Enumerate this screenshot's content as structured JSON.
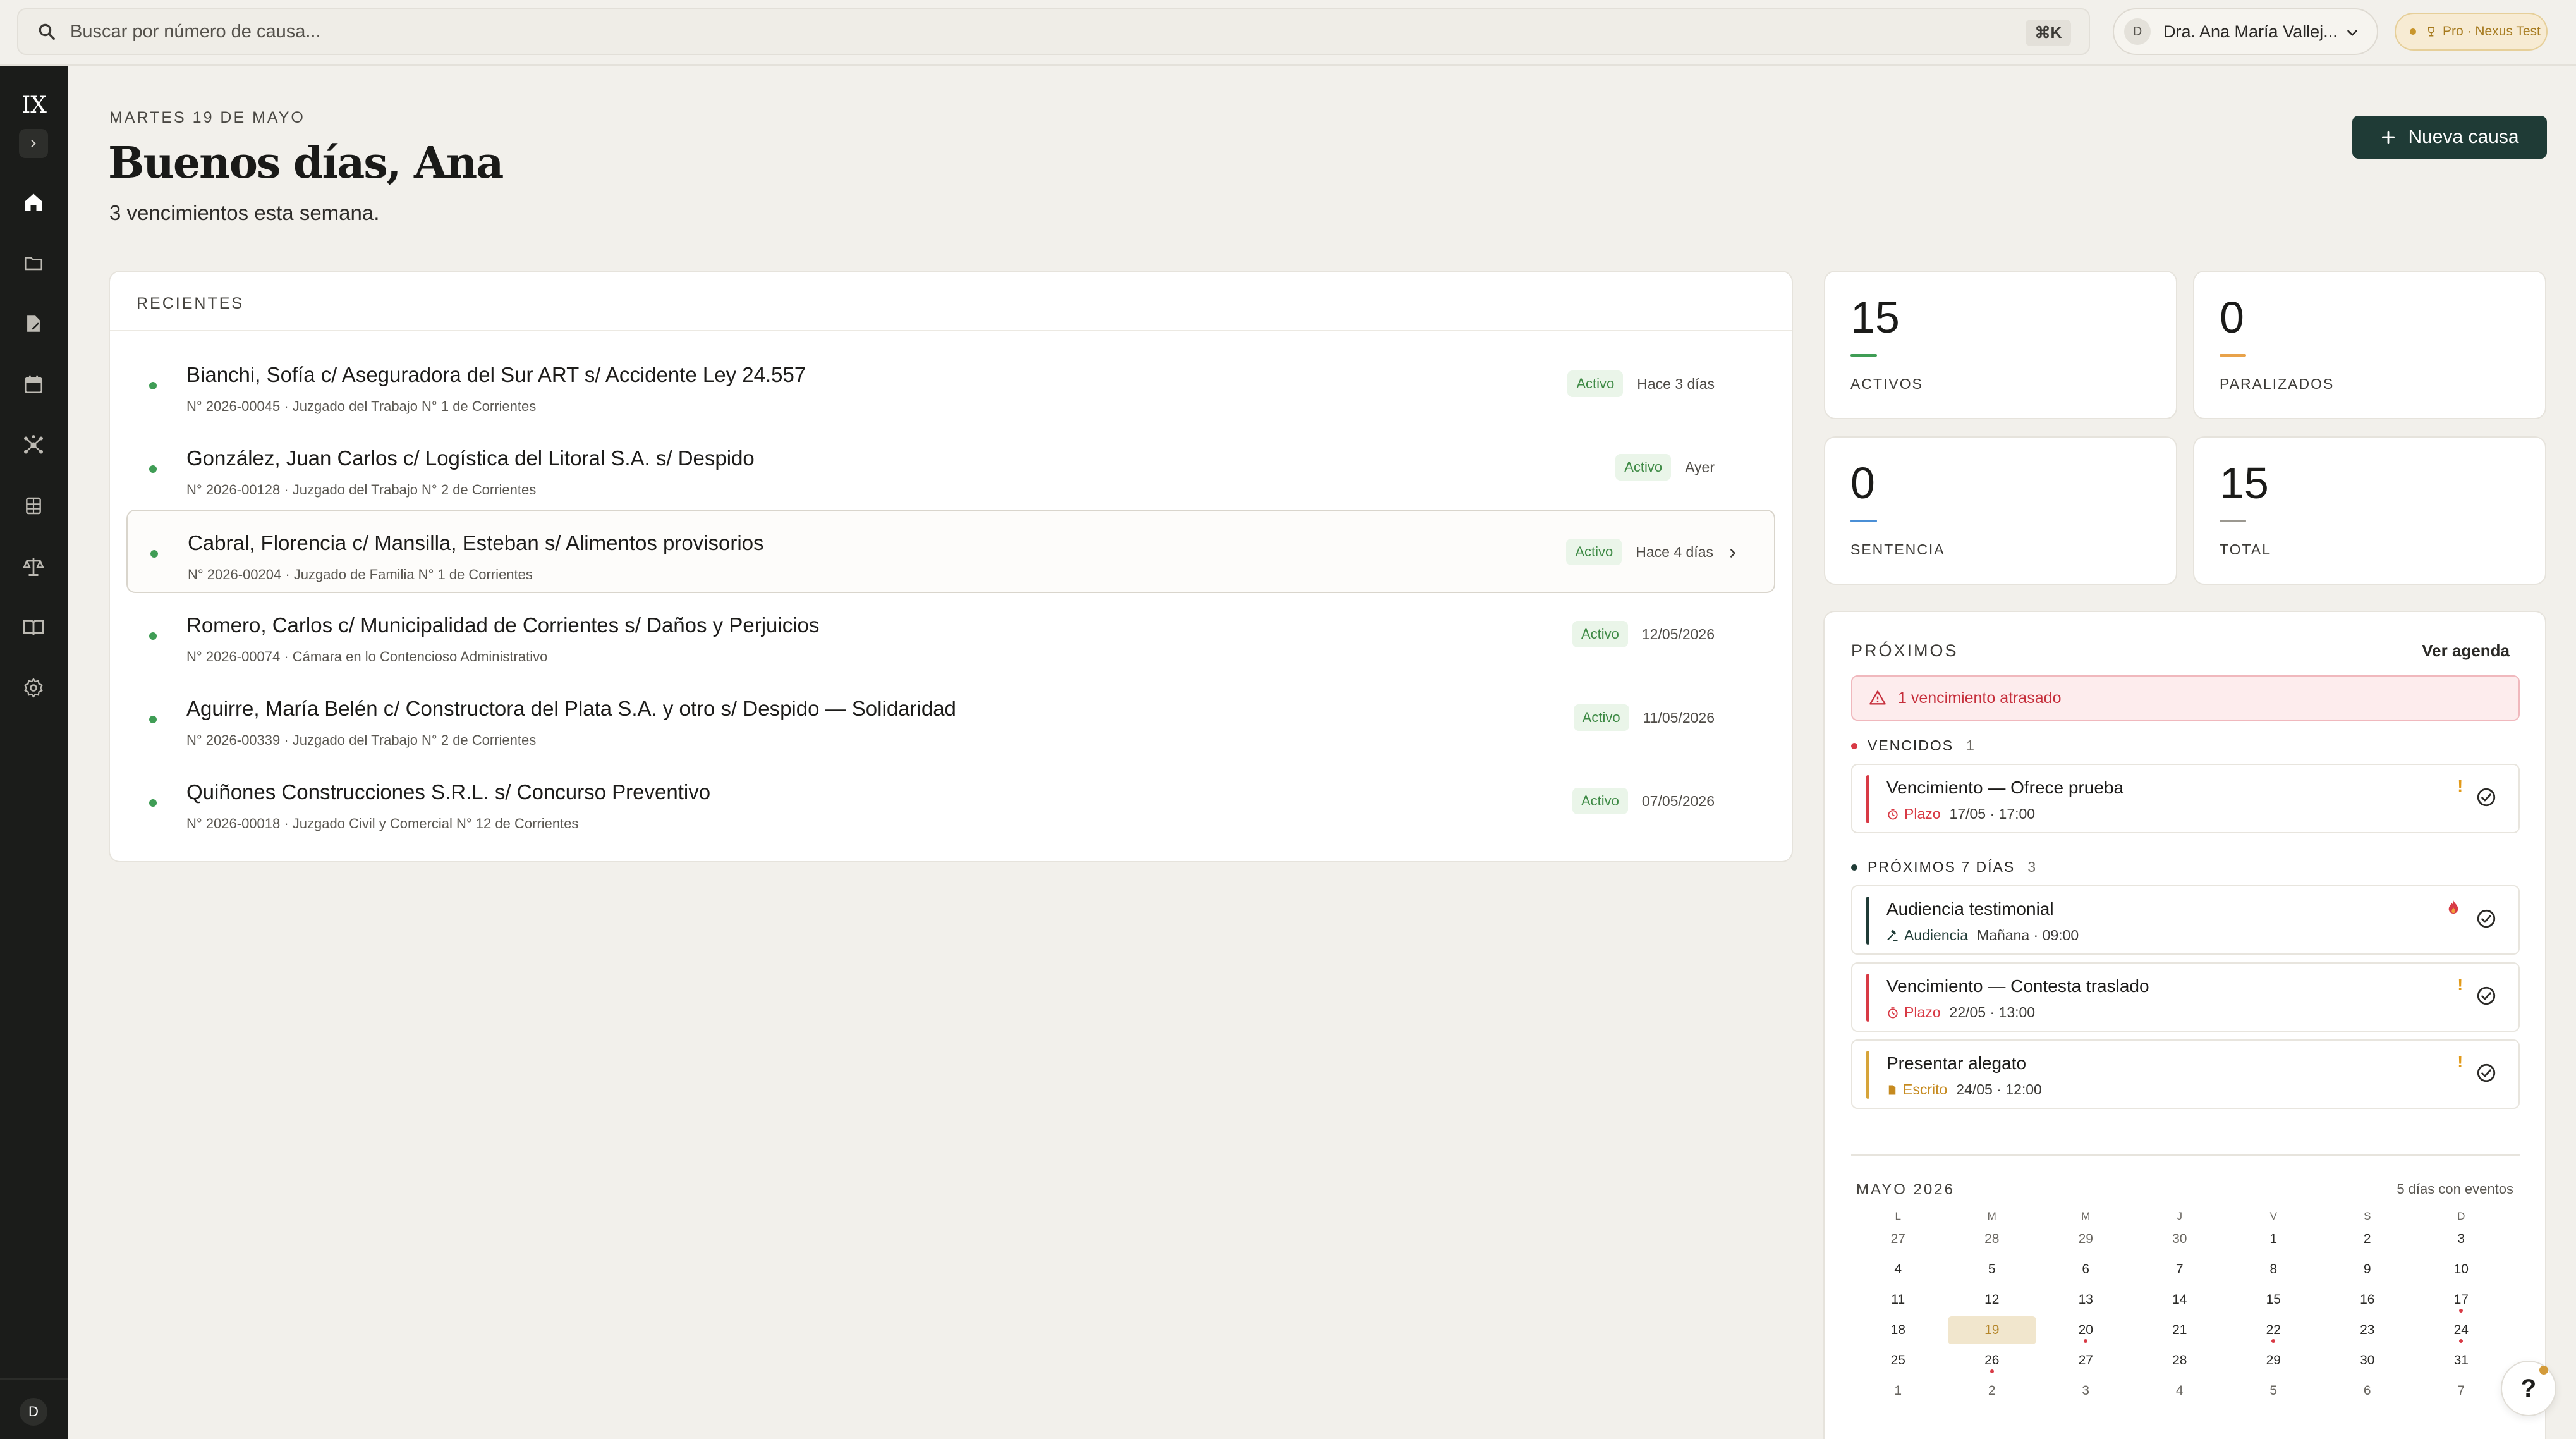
{
  "search": {
    "placeholder": "Buscar por número de causa...",
    "shortcut": "⌘K"
  },
  "user": {
    "initial": "D",
    "name": "Dra. Ana María Vallej..."
  },
  "plan": {
    "label": "Pro · Nexus Test"
  },
  "sidebar": {
    "logo": "IX",
    "avatar": "D",
    "items": [
      {
        "icon": "home-icon"
      },
      {
        "icon": "folder-icon"
      },
      {
        "icon": "document-edit-icon"
      },
      {
        "icon": "calendar-icon"
      },
      {
        "icon": "network-icon"
      },
      {
        "icon": "calculator-icon"
      },
      {
        "icon": "scale-icon"
      },
      {
        "icon": "book-icon"
      },
      {
        "icon": "gear-icon"
      }
    ]
  },
  "header": {
    "date": "MARTES 19 DE MAYO",
    "greeting": "Buenos días, Ana",
    "summary": "3 vencimientos esta semana.",
    "new_case": "Nueva causa"
  },
  "recents": {
    "title": "RECIENTES",
    "rows": [
      {
        "title": "Bianchi, Sofía c/ Aseguradora del Sur ART s/ Accidente Ley 24.557",
        "sub": "N° 2026-00045 · Juzgado del Trabajo N° 1 de Corrientes",
        "status": "Activo",
        "time": "Hace 3 días"
      },
      {
        "title": "González, Juan Carlos c/ Logística del Litoral S.A. s/ Despido",
        "sub": "N° 2026-00128 · Juzgado del Trabajo N° 2 de Corrientes",
        "status": "Activo",
        "time": "Ayer"
      },
      {
        "title": "Cabral, Florencia c/ Mansilla, Esteban s/ Alimentos provisorios",
        "sub": "N° 2026-00204 · Juzgado de Familia N° 1 de Corrientes",
        "status": "Activo",
        "time": "Hace 4 días"
      },
      {
        "title": "Romero, Carlos c/ Municipalidad de Corrientes s/ Daños y Perjuicios",
        "sub": "N° 2026-00074 · Cámara en lo Contencioso Administrativo",
        "status": "Activo",
        "time": "12/05/2026"
      },
      {
        "title": "Aguirre, María Belén c/ Constructora del Plata S.A. y otro s/ Despido — Solidaridad",
        "sub": "N° 2026-00339 · Juzgado del Trabajo N° 2 de Corrientes",
        "status": "Activo",
        "time": "11/05/2026"
      },
      {
        "title": "Quiñones Construcciones S.R.L. s/ Concurso Preventivo",
        "sub": "N° 2026-00018 · Juzgado Civil y Comercial N° 12 de Corrientes",
        "status": "Activo",
        "time": "07/05/2026"
      }
    ]
  },
  "stats": [
    {
      "value": "15",
      "label": "ACTIVOS",
      "color": "#3f9d55"
    },
    {
      "value": "0",
      "label": "PARALIZADOS",
      "color": "#e8a24a"
    },
    {
      "value": "0",
      "label": "SENTENCIA",
      "color": "#4a8fd6"
    },
    {
      "value": "15",
      "label": "TOTAL",
      "color": "#9b9890"
    }
  ],
  "upcoming": {
    "title": "PRÓXIMOS",
    "see_agenda": "Ver agenda",
    "alert": "1 vencimiento atrasado",
    "overdue_label": "VENCIDOS",
    "overdue_count": "1",
    "next_label": "PRÓXIMOS 7 DÍAS",
    "next_count": "3",
    "overdue": [
      {
        "title": "Vencimiento — Ofrece prueba",
        "type": "Plazo",
        "when": "17/05 · 17:00",
        "bar": "#d83a45",
        "type_color": "#d83a45",
        "flag": "!"
      }
    ],
    "next": [
      {
        "title": "Audiencia testimonial",
        "type": "Audiencia",
        "when": "Mañana · 09:00",
        "bar": "#1f3b36",
        "type_color": "#1f3b36",
        "flag": "fire"
      },
      {
        "title": "Vencimiento — Contesta traslado",
        "type": "Plazo",
        "when": "22/05 · 13:00",
        "bar": "#d83a45",
        "type_color": "#d83a45",
        "flag": "!"
      },
      {
        "title": "Presentar alegato",
        "type": "Escrito",
        "when": "24/05 · 12:00",
        "bar": "#d6a43a",
        "type_color": "#c68a1f",
        "flag": "!"
      }
    ]
  },
  "calendar": {
    "title": "MAYO 2026",
    "note": "5 días con eventos",
    "weekdays": [
      "L",
      "M",
      "M",
      "J",
      "V",
      "S",
      "D"
    ],
    "weeks": [
      [
        "27",
        "28",
        "29",
        "30",
        "1",
        "2",
        "3"
      ],
      [
        "4",
        "5",
        "6",
        "7",
        "8",
        "9",
        "10"
      ],
      [
        "11",
        "12",
        "13",
        "14",
        "15",
        "16",
        "17"
      ],
      [
        "18",
        "19",
        "20",
        "21",
        "22",
        "23",
        "24"
      ],
      [
        "25",
        "26",
        "27",
        "28",
        "29",
        "30",
        "31"
      ],
      [
        "1",
        "2",
        "3",
        "4",
        "5",
        "6",
        "7"
      ]
    ],
    "today": "19",
    "event_days": [
      "17",
      "20",
      "22",
      "24",
      "26"
    ]
  },
  "help": "?"
}
